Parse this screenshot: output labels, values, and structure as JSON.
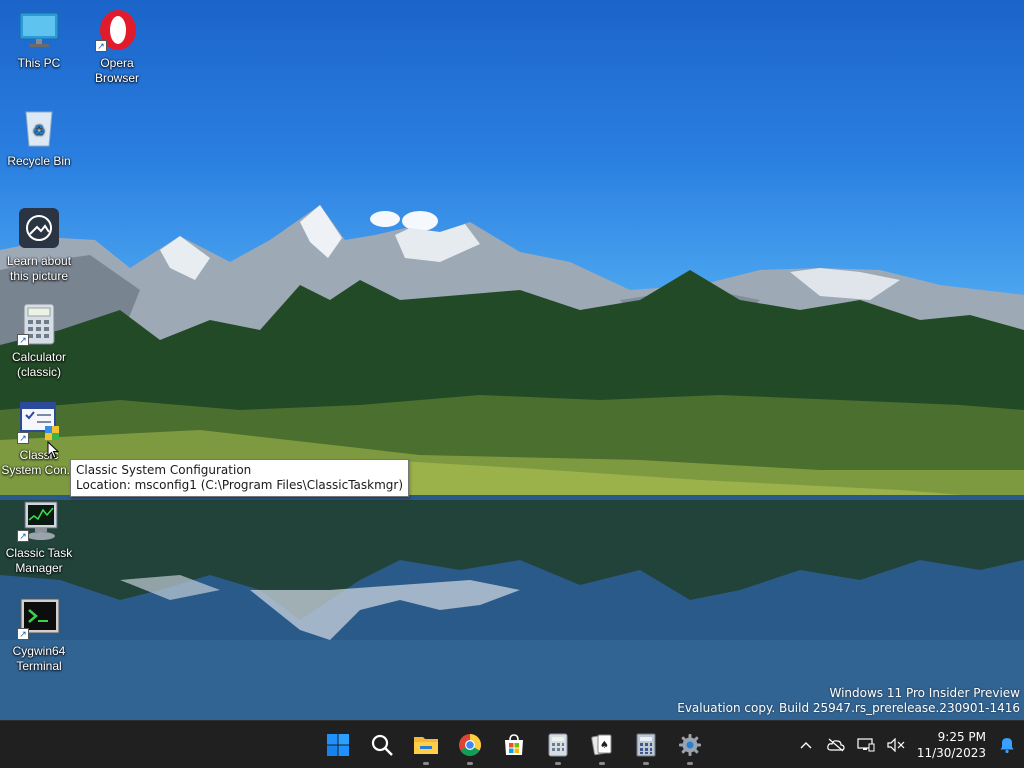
{
  "desktop": {
    "icons": [
      {
        "label": "This PC"
      },
      {
        "label": "Opera Browser"
      },
      {
        "label": "Recycle Bin"
      },
      {
        "label": "Learn about this picture"
      },
      {
        "label": "Calculator (classic)"
      },
      {
        "label": "Classic System Con..."
      },
      {
        "label": "Classic Task Manager"
      },
      {
        "label": "Cygwin64 Terminal"
      }
    ]
  },
  "tooltip": {
    "line1": "Classic System Configuration",
    "line2": "Location: msconfig1 (C:\\Program Files\\ClassicTaskmgr)"
  },
  "watermark": {
    "line1": "Windows 11 Pro Insider Preview",
    "line2": "Evaluation copy. Build 25947.rs_prerelease.230901-1416"
  },
  "taskbar": {
    "apps": [
      {
        "icon": "start-icon"
      },
      {
        "icon": "search-icon"
      },
      {
        "icon": "file-explorer-icon"
      },
      {
        "icon": "chrome-icon"
      },
      {
        "icon": "microsoft-store-icon"
      },
      {
        "icon": "calculator-icon"
      },
      {
        "icon": "solitaire-icon"
      },
      {
        "icon": "classic-calculator-icon"
      },
      {
        "icon": "settings-icon"
      }
    ],
    "tray": {
      "time": "9:25 PM",
      "date": "11/30/2023"
    }
  },
  "colors": {
    "taskbar_bg": "#202020",
    "accent": "#0078d4",
    "start_blue": "#1e90ff"
  }
}
